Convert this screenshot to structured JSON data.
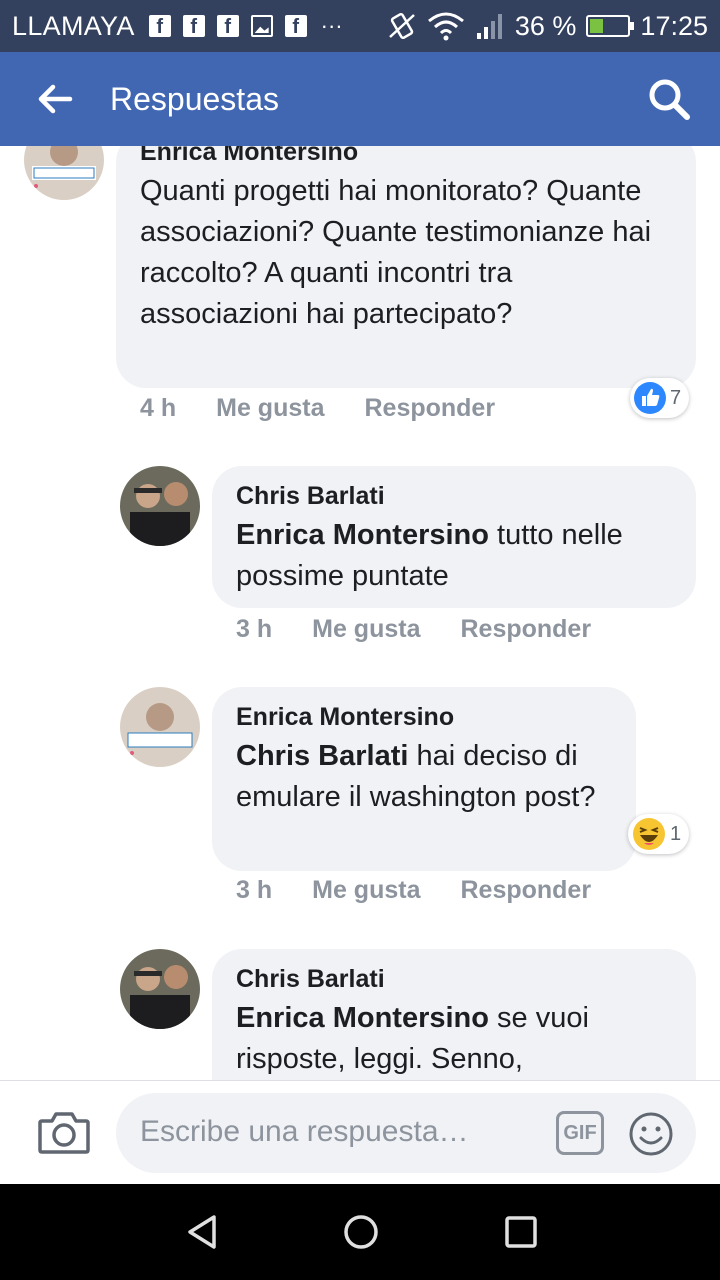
{
  "status_bar": {
    "carrier": "LLAMAYA",
    "notification_icons": [
      "facebook-icon",
      "facebook-icon",
      "facebook-icon",
      "image-icon",
      "facebook-icon"
    ],
    "overflow": "···",
    "battery_percent": "36 %",
    "battery_level": 0.36,
    "time": "17:25"
  },
  "app_bar": {
    "title": "Respuestas",
    "back_icon": "arrow-left-icon",
    "search_icon": "search-icon",
    "color": "#4267b2"
  },
  "comments": [
    {
      "author": "Enrica Montersino",
      "mention": "",
      "text": "Quanti progetti hai monitorato? Quante associazioni? Quante testimonianze hai raccolto? A quanti incontri tra associazioni hai partecipato?",
      "time": "4 h",
      "like_label": "Me gusta",
      "reply_label": "Responder",
      "reaction": {
        "icon": "like-icon",
        "count": "7"
      },
      "avatar_badge": "#WithRefugees"
    },
    {
      "author": "Chris Barlati",
      "mention": "Enrica Montersino",
      "text": " tutto nelle possime puntate",
      "time": "3 h",
      "like_label": "Me gusta",
      "reply_label": "Responder"
    },
    {
      "author": "Enrica Montersino",
      "mention": "Chris Barlati",
      "text": " hai deciso di emulare il washington post?",
      "time": "3 h",
      "like_label": "Me gusta",
      "reply_label": "Responder",
      "reaction": {
        "icon": "haha-icon",
        "count": "1"
      },
      "avatar_badge": "#WithRefugees"
    },
    {
      "author": "Chris Barlati",
      "mention": "Enrica Montersino",
      "text": " se vuoi risposte, leggi. Senno,"
    }
  ],
  "input_bar": {
    "placeholder": "Escribe una respuesta…",
    "gif_label": "GIF"
  }
}
